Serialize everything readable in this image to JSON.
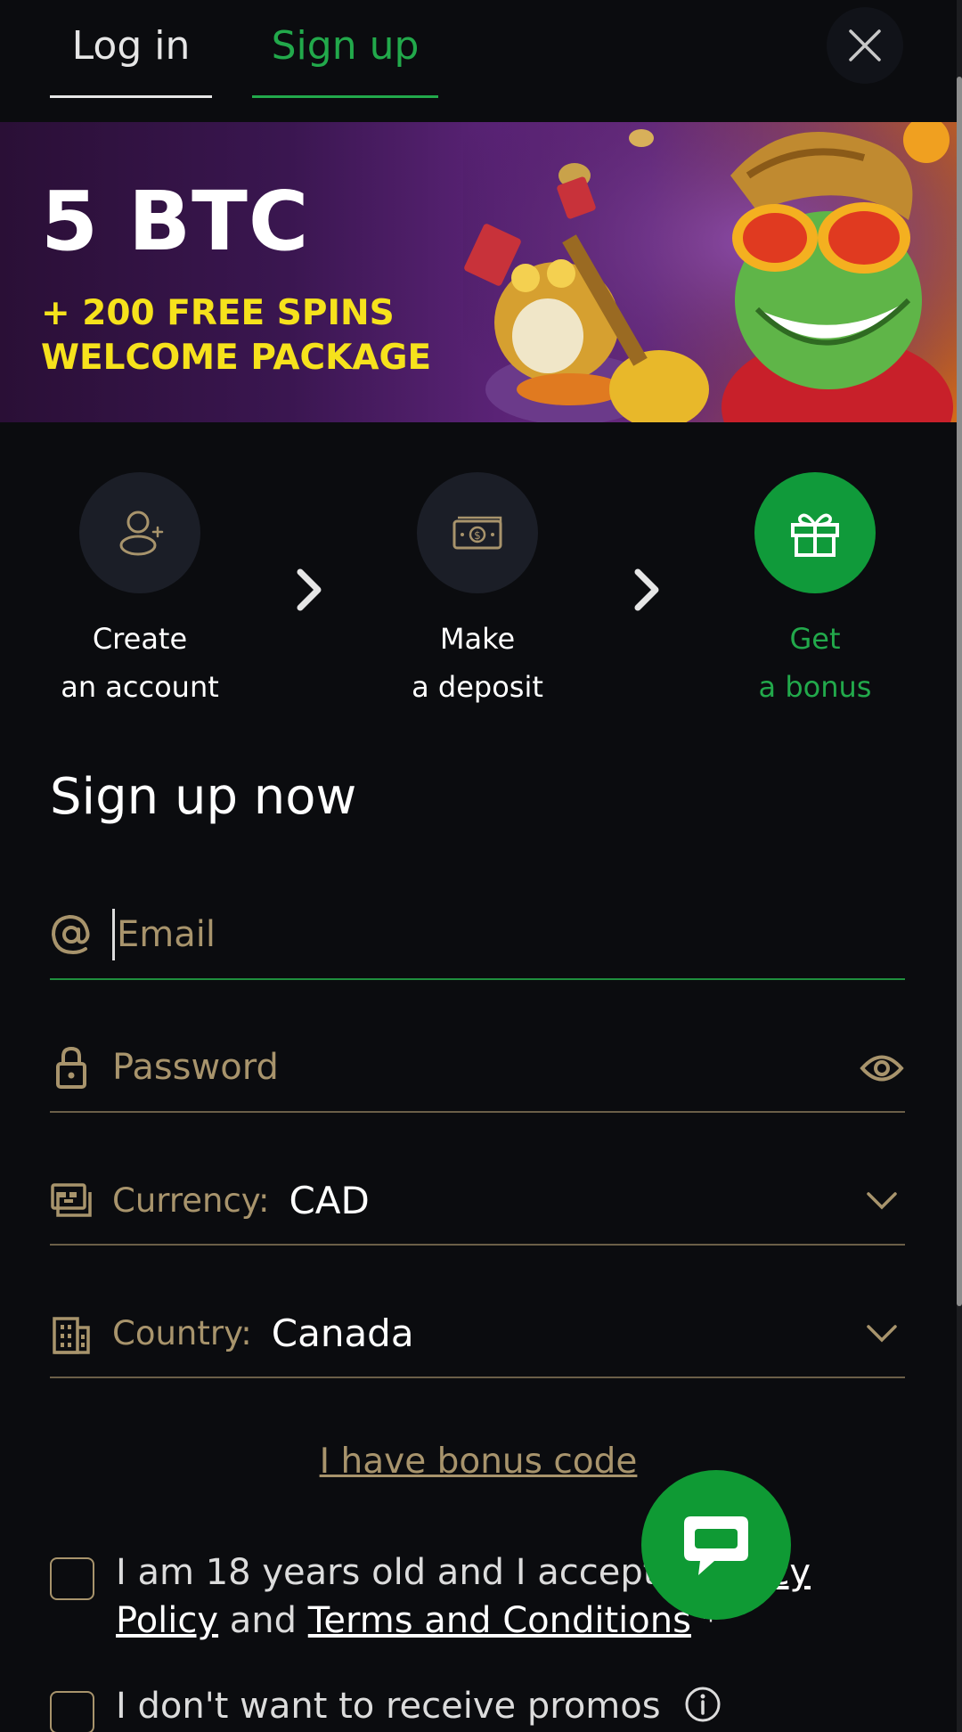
{
  "tabs": {
    "login": "Log in",
    "signup": "Sign up"
  },
  "banner": {
    "title": "5 BTC",
    "line1": "+ 200 FREE SPINS",
    "line2": "WELCOME PACKAGE"
  },
  "steps": [
    {
      "line1": "Create",
      "line2": "an account"
    },
    {
      "line1": "Make",
      "line2": "a deposit"
    },
    {
      "line1": "Get",
      "line2": "a bonus"
    }
  ],
  "form": {
    "title": "Sign up now",
    "email_placeholder": "Email",
    "password_placeholder": "Password",
    "currency_label": "Currency:",
    "currency_value": "CAD",
    "country_label": "Country:",
    "country_value": "Canada"
  },
  "bonus_link": "I have bonus code",
  "consent": {
    "part1": "I am 18 years old and I accept th",
    "privacy_tail": "icy",
    "privacy_line2": "Policy",
    "and": " and ",
    "terms": "Terms and Conditions",
    "asterisk": "*"
  },
  "promos_label": "I don't want to receive promos",
  "colors": {
    "background": "#0b0c0f",
    "accent_green": "#22a94b",
    "gold": "#a8946c",
    "banner_yellow": "#f6e21c"
  },
  "icons": [
    "close-icon",
    "user-plus-icon",
    "banknote-icon",
    "gift-icon",
    "chevron-right-icon",
    "at-icon",
    "lock-icon",
    "eye-icon",
    "currency-icon",
    "building-icon",
    "chevron-down-icon",
    "chat-icon",
    "info-icon"
  ]
}
